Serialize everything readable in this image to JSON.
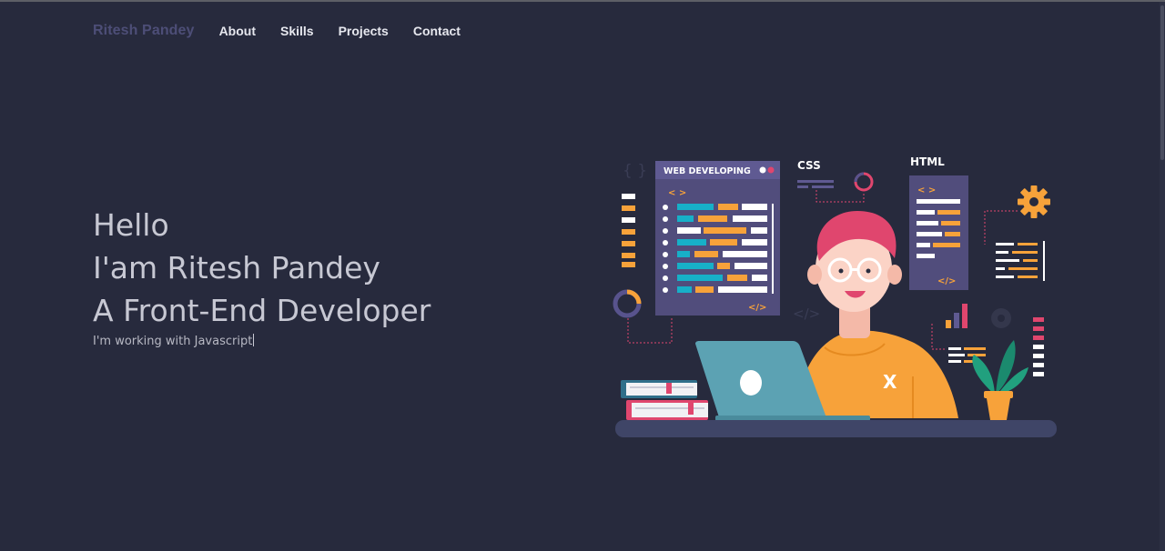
{
  "nav": {
    "brand": "Ritesh Pandey",
    "links": [
      "About",
      "Skills",
      "Projects",
      "Contact"
    ]
  },
  "hero": {
    "lines": [
      "Hello",
      "I'am Ritesh Pandey",
      "A Front-End Developer"
    ],
    "typed": "I'm working with Javascript"
  },
  "illustration": {
    "panel_title": "WEB DEVELOPING",
    "css_label": "CSS",
    "html_label": "HTML",
    "tag_open": "< >",
    "tag_close": "</>",
    "shirt_mark": "X"
  },
  "colors": {
    "background": "#272a3d",
    "brand": "#4d4e77",
    "accent_orange": "#f7a23a",
    "accent_pink": "#e0466e",
    "accent_teal": "#17b0c8"
  }
}
